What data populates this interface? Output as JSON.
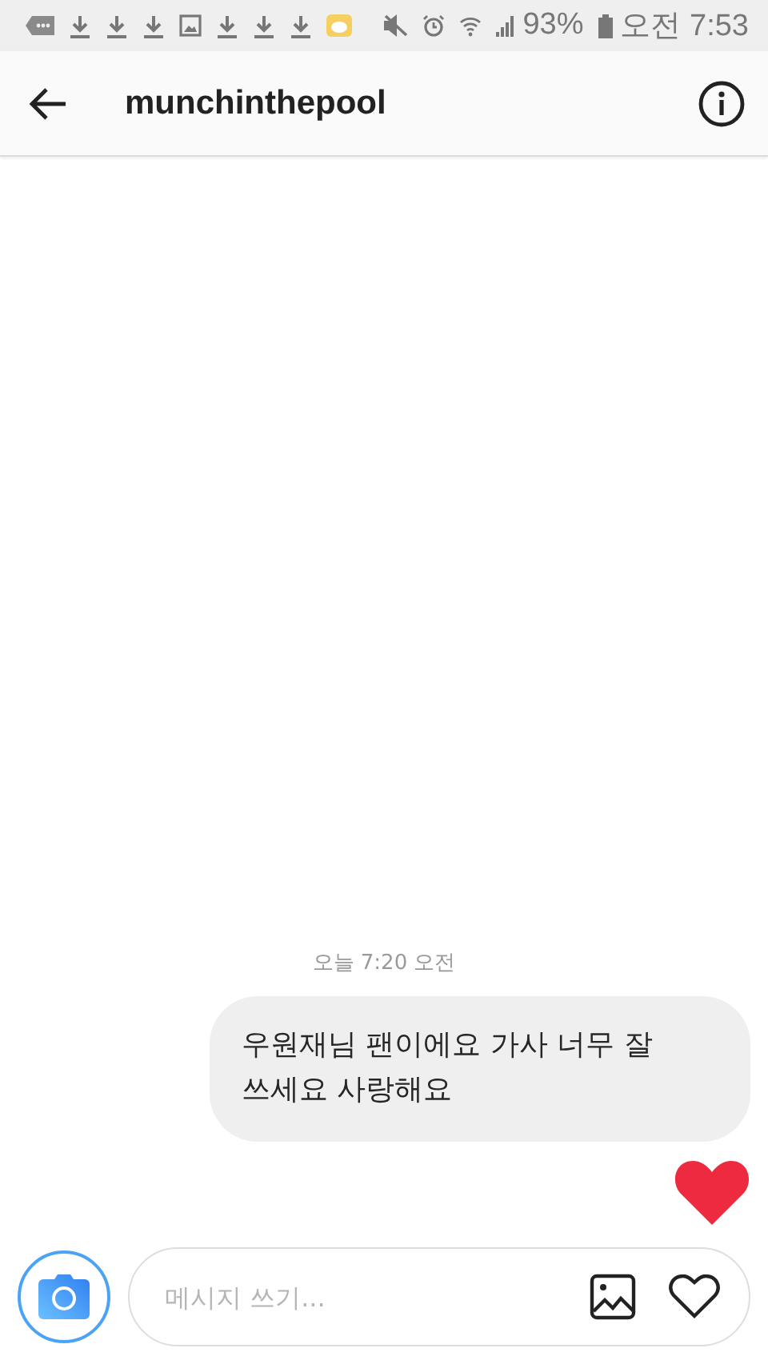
{
  "status_bar": {
    "battery": "93%",
    "time": "오전 7:53"
  },
  "header": {
    "title": "munchinthepool"
  },
  "thread": {
    "timestamp": "오늘 7:20 오전",
    "messages": [
      {
        "kind": "text",
        "text": "우원재님 팬이에요 가사 너무 잘쓰세요 사랑해요"
      },
      {
        "kind": "like"
      }
    ]
  },
  "composer": {
    "placeholder": "메시지 쓰기..."
  }
}
